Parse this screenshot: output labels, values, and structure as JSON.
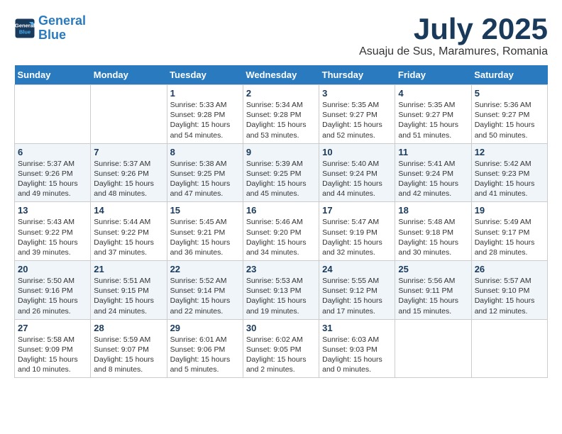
{
  "header": {
    "logo_line1": "General",
    "logo_line2": "Blue",
    "month_year": "July 2025",
    "location": "Asuaju de Sus, Maramures, Romania"
  },
  "weekdays": [
    "Sunday",
    "Monday",
    "Tuesday",
    "Wednesday",
    "Thursday",
    "Friday",
    "Saturday"
  ],
  "weeks": [
    [
      {
        "day": "",
        "sunrise": "",
        "sunset": "",
        "daylight": ""
      },
      {
        "day": "",
        "sunrise": "",
        "sunset": "",
        "daylight": ""
      },
      {
        "day": "1",
        "sunrise": "Sunrise: 5:33 AM",
        "sunset": "Sunset: 9:28 PM",
        "daylight": "Daylight: 15 hours and 54 minutes."
      },
      {
        "day": "2",
        "sunrise": "Sunrise: 5:34 AM",
        "sunset": "Sunset: 9:28 PM",
        "daylight": "Daylight: 15 hours and 53 minutes."
      },
      {
        "day": "3",
        "sunrise": "Sunrise: 5:35 AM",
        "sunset": "Sunset: 9:27 PM",
        "daylight": "Daylight: 15 hours and 52 minutes."
      },
      {
        "day": "4",
        "sunrise": "Sunrise: 5:35 AM",
        "sunset": "Sunset: 9:27 PM",
        "daylight": "Daylight: 15 hours and 51 minutes."
      },
      {
        "day": "5",
        "sunrise": "Sunrise: 5:36 AM",
        "sunset": "Sunset: 9:27 PM",
        "daylight": "Daylight: 15 hours and 50 minutes."
      }
    ],
    [
      {
        "day": "6",
        "sunrise": "Sunrise: 5:37 AM",
        "sunset": "Sunset: 9:26 PM",
        "daylight": "Daylight: 15 hours and 49 minutes."
      },
      {
        "day": "7",
        "sunrise": "Sunrise: 5:37 AM",
        "sunset": "Sunset: 9:26 PM",
        "daylight": "Daylight: 15 hours and 48 minutes."
      },
      {
        "day": "8",
        "sunrise": "Sunrise: 5:38 AM",
        "sunset": "Sunset: 9:25 PM",
        "daylight": "Daylight: 15 hours and 47 minutes."
      },
      {
        "day": "9",
        "sunrise": "Sunrise: 5:39 AM",
        "sunset": "Sunset: 9:25 PM",
        "daylight": "Daylight: 15 hours and 45 minutes."
      },
      {
        "day": "10",
        "sunrise": "Sunrise: 5:40 AM",
        "sunset": "Sunset: 9:24 PM",
        "daylight": "Daylight: 15 hours and 44 minutes."
      },
      {
        "day": "11",
        "sunrise": "Sunrise: 5:41 AM",
        "sunset": "Sunset: 9:24 PM",
        "daylight": "Daylight: 15 hours and 42 minutes."
      },
      {
        "day": "12",
        "sunrise": "Sunrise: 5:42 AM",
        "sunset": "Sunset: 9:23 PM",
        "daylight": "Daylight: 15 hours and 41 minutes."
      }
    ],
    [
      {
        "day": "13",
        "sunrise": "Sunrise: 5:43 AM",
        "sunset": "Sunset: 9:22 PM",
        "daylight": "Daylight: 15 hours and 39 minutes."
      },
      {
        "day": "14",
        "sunrise": "Sunrise: 5:44 AM",
        "sunset": "Sunset: 9:22 PM",
        "daylight": "Daylight: 15 hours and 37 minutes."
      },
      {
        "day": "15",
        "sunrise": "Sunrise: 5:45 AM",
        "sunset": "Sunset: 9:21 PM",
        "daylight": "Daylight: 15 hours and 36 minutes."
      },
      {
        "day": "16",
        "sunrise": "Sunrise: 5:46 AM",
        "sunset": "Sunset: 9:20 PM",
        "daylight": "Daylight: 15 hours and 34 minutes."
      },
      {
        "day": "17",
        "sunrise": "Sunrise: 5:47 AM",
        "sunset": "Sunset: 9:19 PM",
        "daylight": "Daylight: 15 hours and 32 minutes."
      },
      {
        "day": "18",
        "sunrise": "Sunrise: 5:48 AM",
        "sunset": "Sunset: 9:18 PM",
        "daylight": "Daylight: 15 hours and 30 minutes."
      },
      {
        "day": "19",
        "sunrise": "Sunrise: 5:49 AM",
        "sunset": "Sunset: 9:17 PM",
        "daylight": "Daylight: 15 hours and 28 minutes."
      }
    ],
    [
      {
        "day": "20",
        "sunrise": "Sunrise: 5:50 AM",
        "sunset": "Sunset: 9:16 PM",
        "daylight": "Daylight: 15 hours and 26 minutes."
      },
      {
        "day": "21",
        "sunrise": "Sunrise: 5:51 AM",
        "sunset": "Sunset: 9:15 PM",
        "daylight": "Daylight: 15 hours and 24 minutes."
      },
      {
        "day": "22",
        "sunrise": "Sunrise: 5:52 AM",
        "sunset": "Sunset: 9:14 PM",
        "daylight": "Daylight: 15 hours and 22 minutes."
      },
      {
        "day": "23",
        "sunrise": "Sunrise: 5:53 AM",
        "sunset": "Sunset: 9:13 PM",
        "daylight": "Daylight: 15 hours and 19 minutes."
      },
      {
        "day": "24",
        "sunrise": "Sunrise: 5:55 AM",
        "sunset": "Sunset: 9:12 PM",
        "daylight": "Daylight: 15 hours and 17 minutes."
      },
      {
        "day": "25",
        "sunrise": "Sunrise: 5:56 AM",
        "sunset": "Sunset: 9:11 PM",
        "daylight": "Daylight: 15 hours and 15 minutes."
      },
      {
        "day": "26",
        "sunrise": "Sunrise: 5:57 AM",
        "sunset": "Sunset: 9:10 PM",
        "daylight": "Daylight: 15 hours and 12 minutes."
      }
    ],
    [
      {
        "day": "27",
        "sunrise": "Sunrise: 5:58 AM",
        "sunset": "Sunset: 9:09 PM",
        "daylight": "Daylight: 15 hours and 10 minutes."
      },
      {
        "day": "28",
        "sunrise": "Sunrise: 5:59 AM",
        "sunset": "Sunset: 9:07 PM",
        "daylight": "Daylight: 15 hours and 8 minutes."
      },
      {
        "day": "29",
        "sunrise": "Sunrise: 6:01 AM",
        "sunset": "Sunset: 9:06 PM",
        "daylight": "Daylight: 15 hours and 5 minutes."
      },
      {
        "day": "30",
        "sunrise": "Sunrise: 6:02 AM",
        "sunset": "Sunset: 9:05 PM",
        "daylight": "Daylight: 15 hours and 2 minutes."
      },
      {
        "day": "31",
        "sunrise": "Sunrise: 6:03 AM",
        "sunset": "Sunset: 9:03 PM",
        "daylight": "Daylight: 15 hours and 0 minutes."
      },
      {
        "day": "",
        "sunrise": "",
        "sunset": "",
        "daylight": ""
      },
      {
        "day": "",
        "sunrise": "",
        "sunset": "",
        "daylight": ""
      }
    ]
  ]
}
